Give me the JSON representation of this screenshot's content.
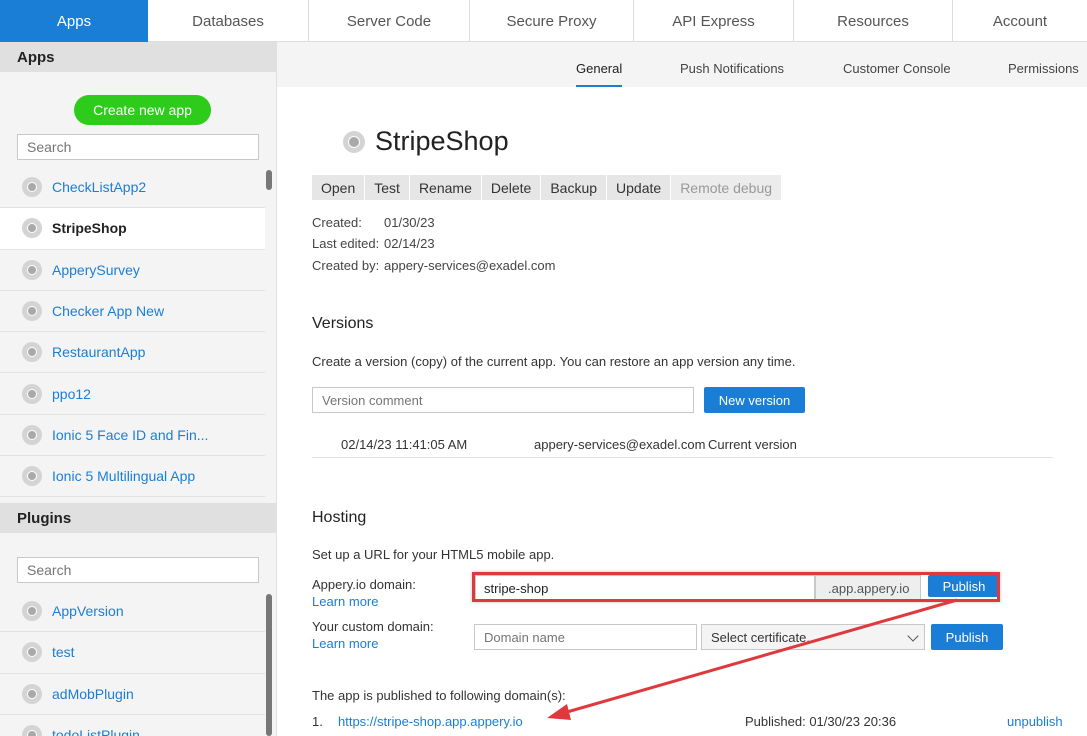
{
  "topnav": {
    "tabs": [
      {
        "label": "Apps",
        "active": true
      },
      {
        "label": "Databases"
      },
      {
        "label": "Server Code"
      },
      {
        "label": "Secure Proxy"
      },
      {
        "label": "API Express"
      },
      {
        "label": "Resources"
      },
      {
        "label": "Account"
      }
    ]
  },
  "sidebar": {
    "apps_heading": "Apps",
    "create_label": "Create new app",
    "search_placeholder": "Search",
    "apps": [
      {
        "label": "CheckListApp2"
      },
      {
        "label": "StripeShop",
        "selected": true
      },
      {
        "label": "ApperySurvey"
      },
      {
        "label": "Checker App New"
      },
      {
        "label": "RestaurantApp"
      },
      {
        "label": "ppo12"
      },
      {
        "label": "Ionic 5 Face ID and Fin..."
      },
      {
        "label": "Ionic 5 Multilingual App"
      }
    ],
    "plugins_heading": "Plugins",
    "plugins_search_placeholder": "Search",
    "plugins": [
      {
        "label": "AppVersion"
      },
      {
        "label": "test"
      },
      {
        "label": "adMobPlugin"
      },
      {
        "label": "todoListPlugin"
      }
    ]
  },
  "subnav": {
    "tabs": [
      {
        "label": "General",
        "active": true
      },
      {
        "label": "Push Notifications"
      },
      {
        "label": "Customer Console"
      },
      {
        "label": "Permissions"
      }
    ]
  },
  "app": {
    "title": "StripeShop",
    "toolbar": [
      "Open",
      "Test",
      "Rename",
      "Delete",
      "Backup",
      "Update",
      "Remote debug"
    ],
    "created_label": "Created:",
    "created_value": "01/30/23",
    "edited_label": "Last edited:",
    "edited_value": "02/14/23",
    "createdby_label": "Created by:",
    "createdby_value": "appery-services@exadel.com"
  },
  "versions": {
    "heading": "Versions",
    "description": "Create a version (copy) of the current app. You can restore an app version any time.",
    "comment_placeholder": "Version comment",
    "new_button": "New version",
    "rows": [
      {
        "date": "02/14/23 11:41:05 AM",
        "user": "appery-services@exadel.com",
        "status": "Current version"
      }
    ]
  },
  "hosting": {
    "heading": "Hosting",
    "description": "Set up a URL for your HTML5 mobile app.",
    "appery_label": "Appery.io domain:",
    "learn_more": "Learn more",
    "domain_value": "stripe-shop",
    "domain_suffix": ".app.appery.io",
    "publish_label": "Publish",
    "custom_label": "Your custom domain:",
    "custom_placeholder": "Domain name",
    "certificate_label": "Select certificate...",
    "published_heading": "The app is published to following domain(s):",
    "published": [
      {
        "index": "1.",
        "url": "https://stripe-shop.app.appery.io",
        "published_at": "Published: 01/30/23 20:36",
        "action": "unpublish"
      }
    ]
  },
  "colors": {
    "accent": "#1a7ed6",
    "create": "#2ecc1a",
    "highlight": "#e0383d"
  }
}
